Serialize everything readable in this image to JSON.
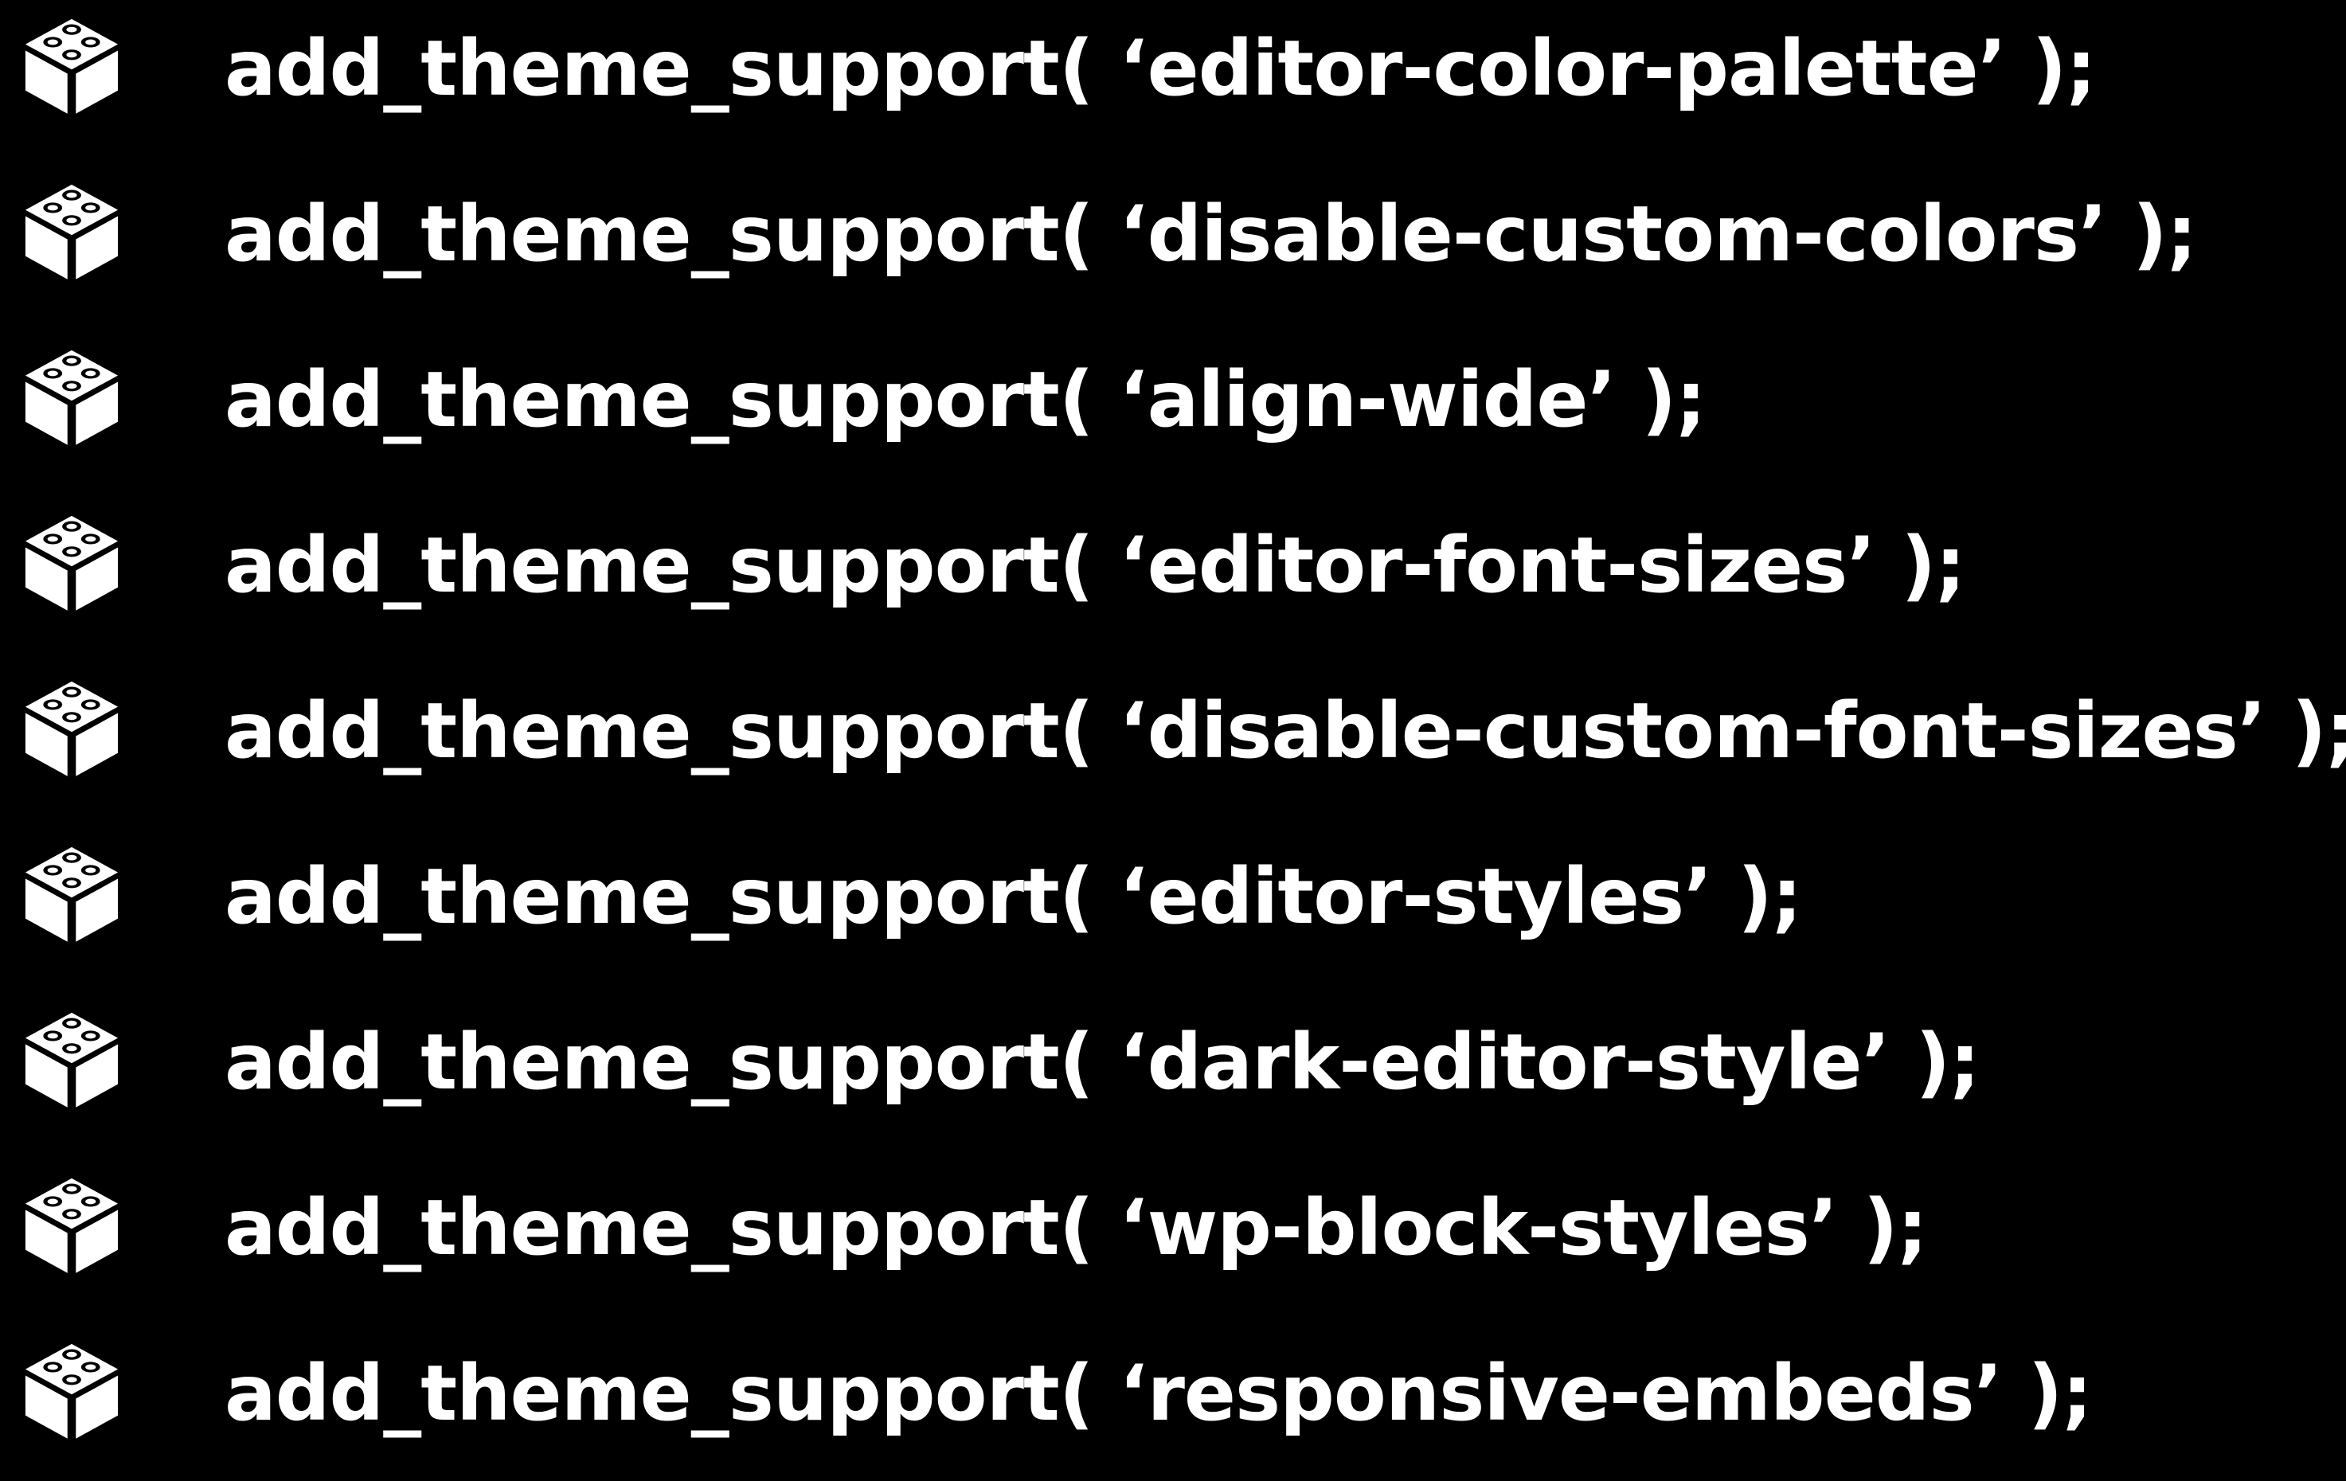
{
  "colors": {
    "background": "#000000",
    "foreground": "#ffffff"
  },
  "items": [
    {
      "icon": "block-icon",
      "code": "add_theme_support( ‘editor-color-palette’ );"
    },
    {
      "icon": "block-icon",
      "code": "add_theme_support( ‘disable-custom-colors’ );"
    },
    {
      "icon": "block-icon",
      "code": "add_theme_support( ‘align-wide’ );"
    },
    {
      "icon": "block-icon",
      "code": "add_theme_support( ‘editor-font-sizes’ );"
    },
    {
      "icon": "block-icon",
      "code": "add_theme_support( ‘disable-custom-font-sizes’ );"
    },
    {
      "icon": "block-icon",
      "code": "add_theme_support( ‘editor-styles’ );"
    },
    {
      "icon": "block-icon",
      "code": "add_theme_support( ‘dark-editor-style’ );"
    },
    {
      "icon": "block-icon",
      "code": "add_theme_support( ‘wp-block-styles’ );"
    },
    {
      "icon": "block-icon",
      "code": "add_theme_support( ‘responsive-embeds’ );"
    }
  ]
}
